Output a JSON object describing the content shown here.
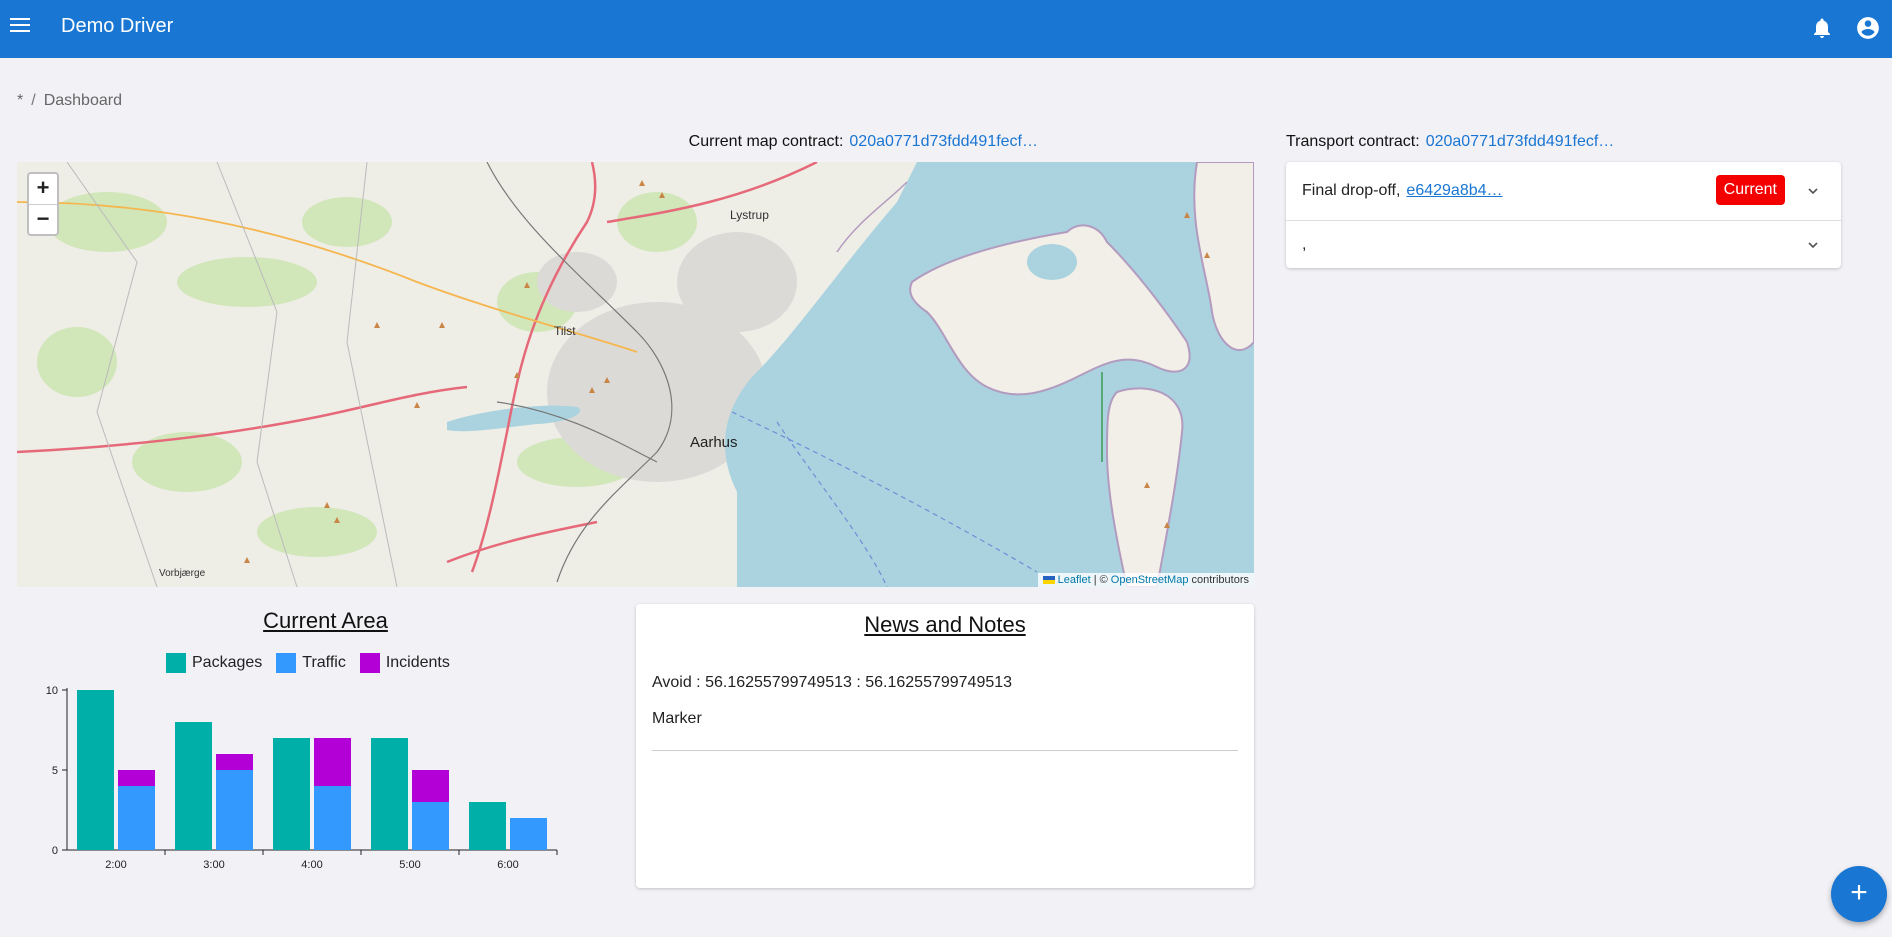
{
  "appbar": {
    "title": "Demo Driver",
    "menu_icon": "menu-icon",
    "notification_icon": "bell-icon",
    "account_icon": "account-circle-icon",
    "color": "#1976d2"
  },
  "breadcrumb": {
    "root": "*",
    "separator": "/",
    "current": "Dashboard"
  },
  "map_contract": {
    "label": "Current map contract:",
    "value": "020a0771d73fdd491fecf…"
  },
  "transport_contract": {
    "label": "Transport contract:",
    "value": "020a0771d73fdd491fecf…"
  },
  "map": {
    "zoom_in": "+",
    "zoom_out": "−",
    "city": "Aarhus",
    "places": [
      "Lystrup",
      "Tilst",
      "Vorbjærge"
    ],
    "attribution": {
      "leaflet": "Leaflet",
      "separator": "| ©",
      "osm": "OpenStreetMap",
      "suffix": "contributors"
    }
  },
  "transports": [
    {
      "label": "Final drop-off,",
      "id": "e6429a8b4…",
      "badge": "Current"
    },
    {
      "label": ",",
      "id": "",
      "badge": ""
    }
  ],
  "news": {
    "title": "News and Notes",
    "items": [
      {
        "text": "Avoid : 56.16255799749513 : 56.16255799749513",
        "sub": "Marker"
      }
    ]
  },
  "fab_label": "+",
  "chart_data": {
    "type": "bar",
    "title": "Current Area",
    "categories": [
      "2:00",
      "3:00",
      "4:00",
      "5:00",
      "6:00"
    ],
    "series": [
      {
        "name": "Packages",
        "values": [
          10,
          8,
          7,
          7,
          3
        ],
        "color": "#00b0a8"
      },
      {
        "name": "Traffic",
        "values": [
          4,
          5,
          4,
          3,
          2
        ],
        "color": "#3399ff",
        "stack": "b"
      },
      {
        "name": "Incidents",
        "values": [
          1,
          1,
          3,
          2,
          0
        ],
        "color": "#b300d6",
        "stack": "b"
      }
    ],
    "yticks": [
      0,
      5,
      10
    ],
    "ylim": [
      0,
      10
    ],
    "legend": "top",
    "grid": false
  }
}
